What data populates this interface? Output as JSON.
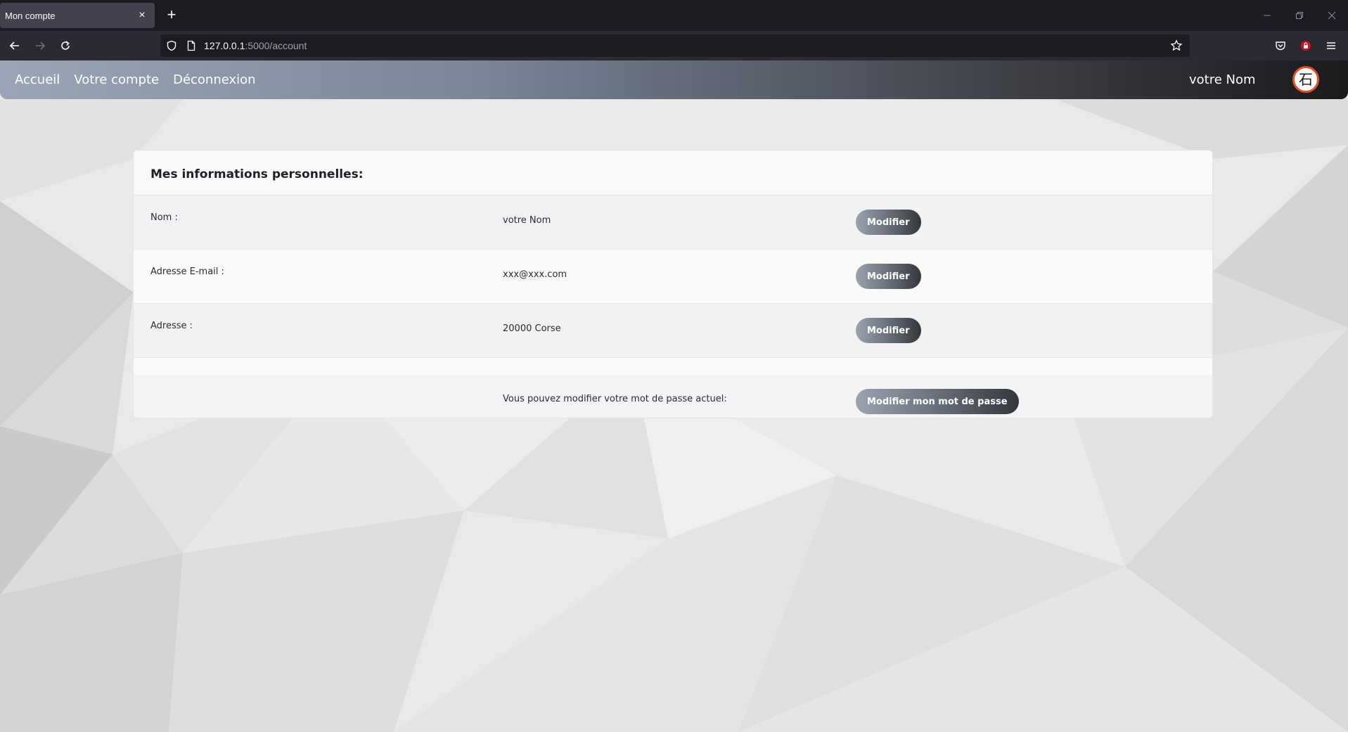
{
  "browser": {
    "tab_title": "Mon compte",
    "tab_close_icon": "×",
    "new_tab_icon": "+",
    "url_host": "127.0.0.1",
    "url_rest": ":5000/account",
    "window_buttons": [
      "minimize-icon",
      "restore-icon",
      "close-icon"
    ]
  },
  "site": {
    "nav": [
      "Accueil",
      "Votre compte",
      "Déconnexion"
    ],
    "user_name": "votre Nom",
    "logo_glyph": "石",
    "colors": {
      "logo_ring": "#e0522a"
    }
  },
  "account": {
    "title": "Mes informations personnelles:",
    "rows": [
      {
        "label": "Nom :",
        "value": "votre Nom",
        "button": "Modifier"
      },
      {
        "label": "Adresse E-mail :",
        "value": "xxx@xxx.com",
        "button": "Modifier"
      },
      {
        "label": "Adresse :",
        "value": "20000 Corse",
        "button": "Modifier"
      }
    ],
    "password": {
      "text": "Vous pouvez modifier votre mot de passe actuel:",
      "button": "Modifier mon mot de passe"
    }
  }
}
